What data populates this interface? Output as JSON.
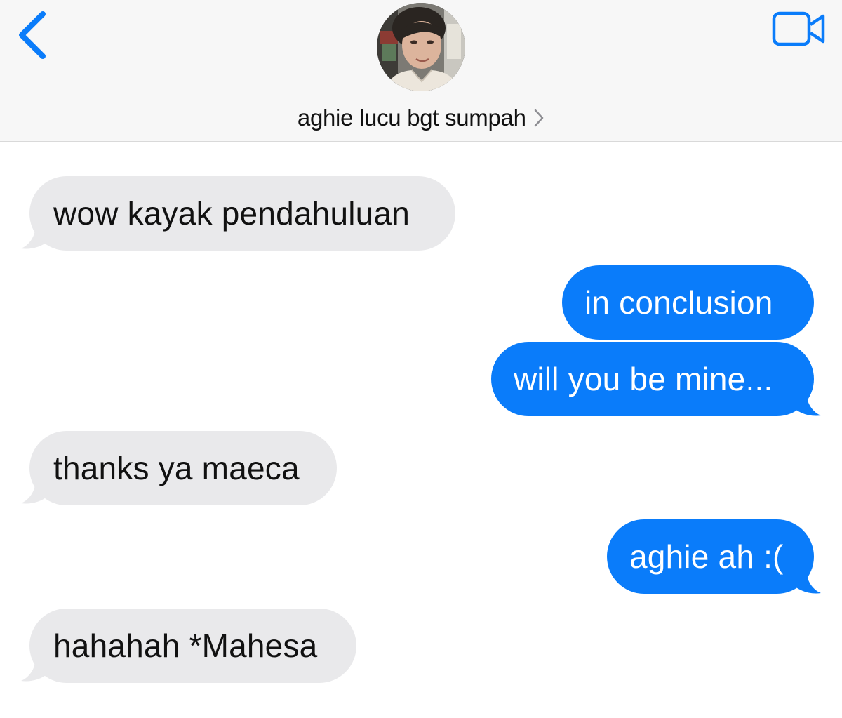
{
  "header": {
    "contact_name": "aghie lucu bgt sumpah",
    "back_icon": "chevron-left-icon",
    "video_icon": "video-camera-icon",
    "details_icon": "chevron-right-icon",
    "accent_color": "#0a7cfa"
  },
  "messages": [
    {
      "direction": "incoming",
      "text": "wow kayak pendahuluan"
    },
    {
      "direction": "outgoing",
      "text": "in conclusion"
    },
    {
      "direction": "outgoing",
      "text": "will you be mine..."
    },
    {
      "direction": "incoming",
      "text": "thanks ya maeca"
    },
    {
      "direction": "outgoing",
      "text": "aghie ah :("
    },
    {
      "direction": "incoming",
      "text": "hahahah *Mahesa"
    }
  ],
  "colors": {
    "incoming_bubble": "#e9e9eb",
    "outgoing_bubble": "#0a7cfa",
    "incoming_text": "#111111",
    "outgoing_text": "#ffffff"
  }
}
